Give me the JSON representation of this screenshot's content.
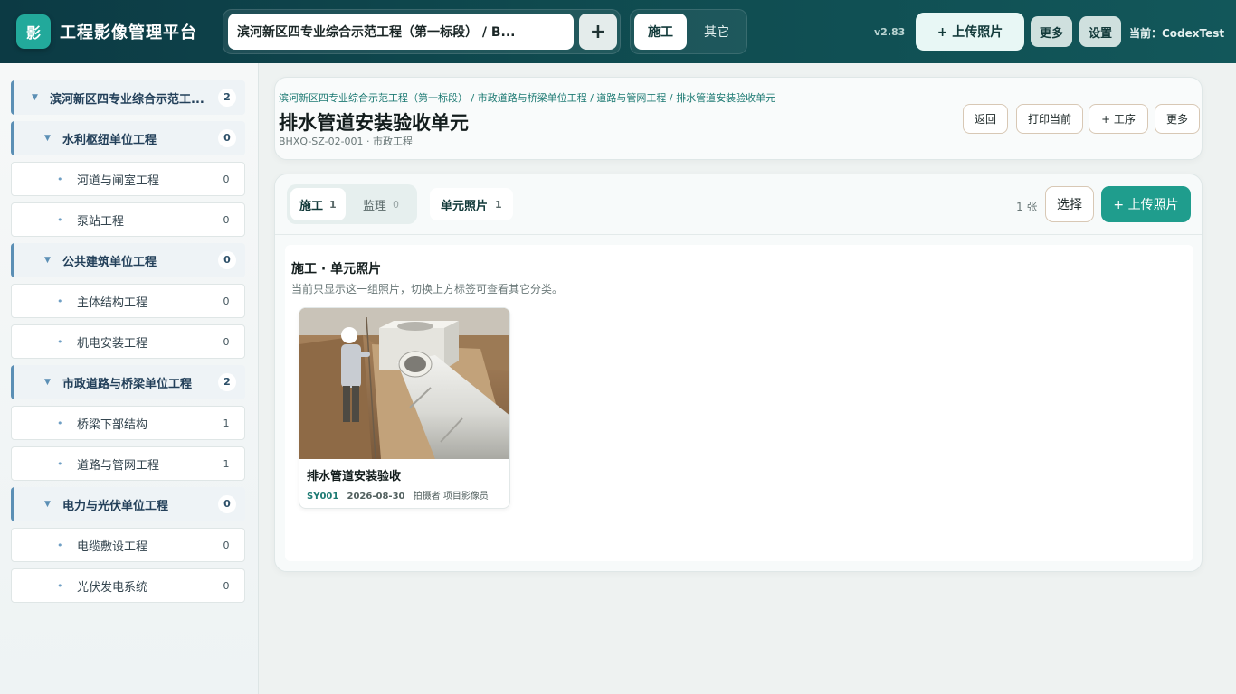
{
  "topbar": {
    "logo_char": "影",
    "app_title": "工程影像管理平台",
    "project_name": "滨河新区四专业综合示范工程（第一标段） / B...",
    "add_symbol": "+",
    "mode_tabs": [
      {
        "label": "施工",
        "active": true
      },
      {
        "label": "其它",
        "active": false
      }
    ],
    "version": "v2.83",
    "upload_label": "+ 上传照片",
    "more_label": "更多",
    "settings_label": "设置",
    "current_user": "当前：CodexTest"
  },
  "sidebar": {
    "items": [
      {
        "label": "滨河新区四专业综合示范工...",
        "count": "2",
        "level": 0
      },
      {
        "label": "水利枢纽单位工程",
        "count": "0",
        "level": 1
      },
      {
        "label": "河道与闸室工程",
        "count": "0",
        "level": 2
      },
      {
        "label": "泵站工程",
        "count": "0",
        "level": 2
      },
      {
        "label": "公共建筑单位工程",
        "count": "0",
        "level": 1
      },
      {
        "label": "主体结构工程",
        "count": "0",
        "level": 2
      },
      {
        "label": "机电安装工程",
        "count": "0",
        "level": 2
      },
      {
        "label": "市政道路与桥梁单位工程",
        "count": "2",
        "level": 1
      },
      {
        "label": "桥梁下部结构",
        "count": "1",
        "level": 2
      },
      {
        "label": "道路与管网工程",
        "count": "1",
        "level": 2
      },
      {
        "label": "电力与光伏单位工程",
        "count": "0",
        "level": 1
      },
      {
        "label": "电缆敷设工程",
        "count": "0",
        "level": 2
      },
      {
        "label": "光伏发电系统",
        "count": "0",
        "level": 2
      }
    ]
  },
  "header": {
    "breadcrumb": "滨河新区四专业综合示范工程（第一标段） / 市政道路与桥梁单位工程 / 道路与管网工程 / 排水管道安装验收单元",
    "title": "排水管道安装验收单元",
    "subtitle": "BHXQ-SZ-02-001 · 市政工程",
    "buttons": {
      "back": "返回",
      "print": "打印当前",
      "add_process": "+ 工序",
      "more": "更多"
    }
  },
  "content": {
    "tabs": [
      {
        "label": "施工",
        "count": "1",
        "active": true
      },
      {
        "label": "监理",
        "count": "0",
        "active": false
      }
    ],
    "unit_tab": {
      "label": "单元照片",
      "count": "1"
    },
    "photo_count": "1 张",
    "select_label": "选择",
    "upload_label": "+ 上传照片",
    "section_title": "施工 · 单元照片",
    "section_desc": "当前只显示这一组照片，切换上方标签可查看其它分类。",
    "photos": [
      {
        "title": "排水管道安装验收",
        "code": "SY001",
        "date": "2026-08-30",
        "photographer": "拍摄者 项目影像员"
      }
    ]
  },
  "colors": {
    "topbar_dark": "#0c3a44",
    "accent": "#1f9d8d",
    "link": "#1d7a73",
    "tree_accent": "#5b8fb5"
  }
}
